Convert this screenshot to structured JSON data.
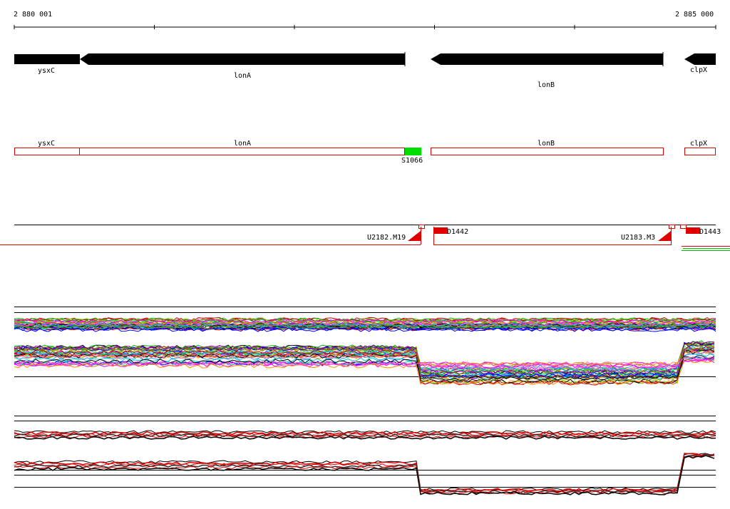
{
  "coords": {
    "start": "2 880 001",
    "end": "2 885 000"
  },
  "genes": [
    {
      "name": "ysxC",
      "label": "ysxC"
    },
    {
      "name": "lonA",
      "label": "lonA"
    },
    {
      "name": "lonB",
      "label": "lonB"
    },
    {
      "name": "clpX",
      "label": "clpX"
    }
  ],
  "features": {
    "ysxC": "ysxC",
    "lonA": "lonA",
    "lonB": "lonB",
    "clpX": "clpX",
    "s_label": "S1066"
  },
  "probes": {
    "u1": "U2182.M19",
    "d1": "D1442",
    "u2": "U2183.M3",
    "d2": "D1443"
  },
  "colors": {
    "gene": "#000000",
    "feature": "#e00000",
    "highlight": "#00dd00"
  }
}
